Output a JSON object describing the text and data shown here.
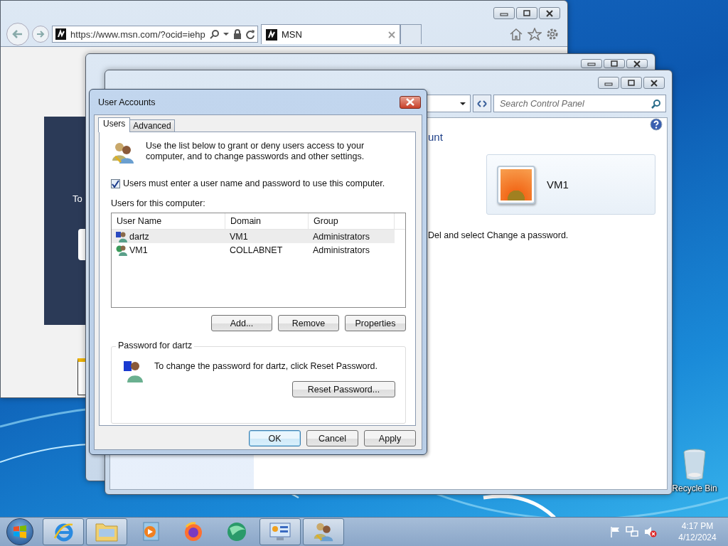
{
  "browser": {
    "url": "https://www.msn.com/?ocid=iehp",
    "tab": "MSN",
    "page_text": "To"
  },
  "control_panel": {
    "search": {
      "placeholder": "Search Control Panel"
    },
    "heading": "unt",
    "account_name": "VM1",
    "note": "Del and select Change a password."
  },
  "dialog": {
    "title": "User Accounts",
    "tabs": [
      {
        "label": "Users",
        "selected": true
      },
      {
        "label": "Advanced",
        "selected": false
      }
    ],
    "intro": "Use the list below to grant or deny users access to your computer, and to change passwords and other settings.",
    "require_password": {
      "label": "Users must enter a user name and password to use this computer.",
      "checked": true
    },
    "list_label": "Users for this computer:",
    "columns": [
      "User Name",
      "Domain",
      "Group"
    ],
    "users": [
      {
        "name": "dartz",
        "domain": "VM1",
        "group": "Administrators",
        "selected": true
      },
      {
        "name": "VM1",
        "domain": "COLLABNET",
        "group": "Administrators",
        "selected": false
      }
    ],
    "list_buttons": [
      "Add...",
      "Remove",
      "Properties"
    ],
    "password_group": {
      "title": "Password for dartz",
      "text": "To change the password for dartz, click Reset Password.",
      "button": "Reset Password..."
    },
    "buttons": [
      {
        "label": "OK",
        "default": true
      },
      {
        "label": "Cancel",
        "default": false
      },
      {
        "label": "Apply",
        "default": false
      }
    ]
  },
  "desktop": {
    "icons": [
      {
        "label": "Recycle Bin"
      }
    ]
  },
  "taskbar": {
    "apps": [
      {
        "kind": "ie",
        "running": true
      },
      {
        "kind": "folder",
        "running": true
      },
      {
        "kind": "media",
        "running": false
      },
      {
        "kind": "firefox",
        "running": false
      },
      {
        "kind": "sphere",
        "running": false
      },
      {
        "kind": "panel",
        "running": true
      },
      {
        "kind": "users",
        "running": true
      }
    ],
    "time": "4:17 PM",
    "date": "4/12/2024"
  }
}
